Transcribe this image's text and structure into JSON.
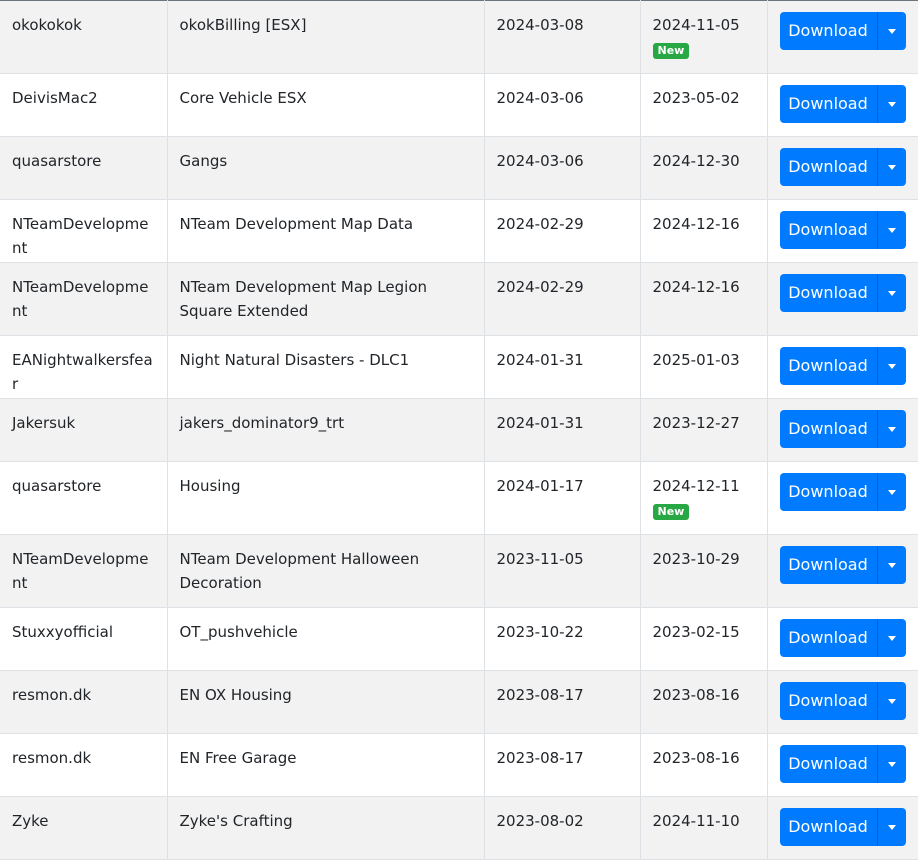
{
  "download_label": "Download",
  "colors": {
    "button": "#007bff",
    "badge": "#28a745"
  },
  "icons": {
    "dropdown": "caret-down-icon"
  },
  "rows": [
    {
      "author": "okokokok",
      "name": "okokBilling [ESX]",
      "released": "2024-03-08",
      "updated": "2024-11-05",
      "badge": "New"
    },
    {
      "author": "DeivisMac2",
      "name": "Core Vehicle ESX",
      "released": "2024-03-06",
      "updated": "2023-05-02",
      "badge": ""
    },
    {
      "author": "quasarstore",
      "name": "Gangs",
      "released": "2024-03-06",
      "updated": "2024-12-30",
      "badge": ""
    },
    {
      "author": "NTeamDevelopment",
      "name": "NTeam Development Map Data",
      "released": "2024-02-29",
      "updated": "2024-12-16",
      "badge": ""
    },
    {
      "author": "NTeamDevelopment",
      "name": "NTeam Development Map Legion Square Extended",
      "released": "2024-02-29",
      "updated": "2024-12-16",
      "badge": ""
    },
    {
      "author": "EANightwalkersfear",
      "name": "Night Natural Disasters - DLC1",
      "released": "2024-01-31",
      "updated": "2025-01-03",
      "badge": ""
    },
    {
      "author": "Jakersuk",
      "name": "jakers_dominator9_trt",
      "released": "2024-01-31",
      "updated": "2023-12-27",
      "badge": ""
    },
    {
      "author": "quasarstore",
      "name": "Housing",
      "released": "2024-01-17",
      "updated": "2024-12-11",
      "badge": "New"
    },
    {
      "author": "NTeamDevelopment",
      "name": "NTeam Development Halloween Decoration",
      "released": "2023-11-05",
      "updated": "2023-10-29",
      "badge": ""
    },
    {
      "author": "Stuxxyofficial",
      "name": "OT_pushvehicle",
      "released": "2023-10-22",
      "updated": "2023-02-15",
      "badge": ""
    },
    {
      "author": "resmon.dk",
      "name": "EN OX Housing",
      "released": "2023-08-17",
      "updated": "2023-08-16",
      "badge": ""
    },
    {
      "author": "resmon.dk",
      "name": "EN Free Garage",
      "released": "2023-08-17",
      "updated": "2023-08-16",
      "badge": ""
    },
    {
      "author": "Zyke",
      "name": "Zyke's Crafting",
      "released": "2023-08-02",
      "updated": "2024-11-10",
      "badge": ""
    }
  ]
}
